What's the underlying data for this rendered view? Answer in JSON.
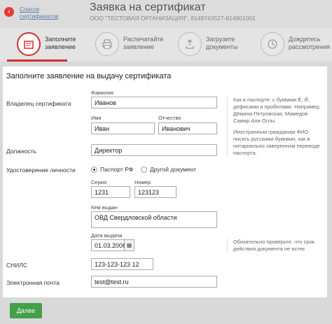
{
  "header": {
    "back_label": "Список сертификатов",
    "back_icon": "‹",
    "title": "Заявка на сертификат",
    "org": "ООО \"ТЕСТОВАЯ ОРГАНИЗАЦИЯ\", 8149743527-814901001"
  },
  "steps": [
    {
      "label": "Заполните заявление",
      "icon": "form-icon",
      "active": true
    },
    {
      "label": "Распечатайте заявление",
      "icon": "printer-icon",
      "active": false
    },
    {
      "label": "Загрузите документы",
      "icon": "upload-icon",
      "active": false
    },
    {
      "label": "Дождитесь рассмотрения",
      "icon": "clock-icon",
      "active": false
    }
  ],
  "form": {
    "title": "Заполните заявление на выдачу сертификата",
    "owner_label": "Владелец сертификата",
    "surname_label": "Фамилия",
    "surname_value": "Иванов",
    "name_label": "Имя",
    "name_value": "Иван",
    "patronymic_label": "Отчество",
    "patronymic_value": "Иванович",
    "hint_1": "Как в паспорте: с буквами Ё, Й, дефисами и пробелами. Например, Дёмина-Петровская, Мамедов Самир Али Оглы.",
    "hint_2": "Иностранным гражданам ФИО писать русскими буквами, как в нотариально заверенном переводе паспорта.",
    "position_label": "Должность",
    "position_value": "Директор",
    "id_label": "Удостоверение личности",
    "id_option_1": "Паспорт РФ",
    "id_option_2": "Другой документ",
    "series_label": "Серия",
    "series_value": "1231",
    "number_label": "Номер",
    "number_value": "123123",
    "issued_by_label": "Кем выдан",
    "issued_by_value": "ОВД Свердловской области",
    "issue_date_label": "Дата выдачи",
    "issue_date_value": "01.03.2006",
    "hint_3": "Обязательно проверьте, что срок действия документа не истек",
    "snils_label": "СНИЛС",
    "snils_value": "123-123-123 12",
    "email_label": "Электронная почта",
    "email_value": "test@test.ru"
  },
  "footer": {
    "next_label": "Далее"
  },
  "colors": {
    "accent": "#d32f2f",
    "primary_button": "#43a047"
  }
}
